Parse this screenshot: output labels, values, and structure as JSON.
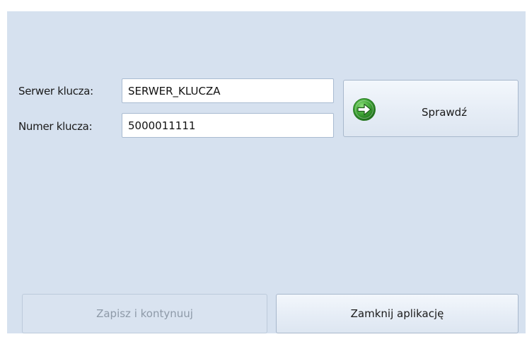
{
  "form": {
    "server_label": "Serwer klucza:",
    "server_value": "SERWER_KLUCZA",
    "number_label": "Numer klucza:",
    "number_value": "5000011111",
    "check_label": "Sprawdź",
    "check_icon": "green-arrow-right-icon"
  },
  "footer": {
    "save_label": "Zapisz i kontynuuj",
    "save_enabled": false,
    "close_label": "Zamknij aplikację"
  },
  "colors": {
    "panel_background": "#d6e1ef",
    "icon_green": "#3fa535",
    "disabled_text": "#8e9aa8"
  }
}
